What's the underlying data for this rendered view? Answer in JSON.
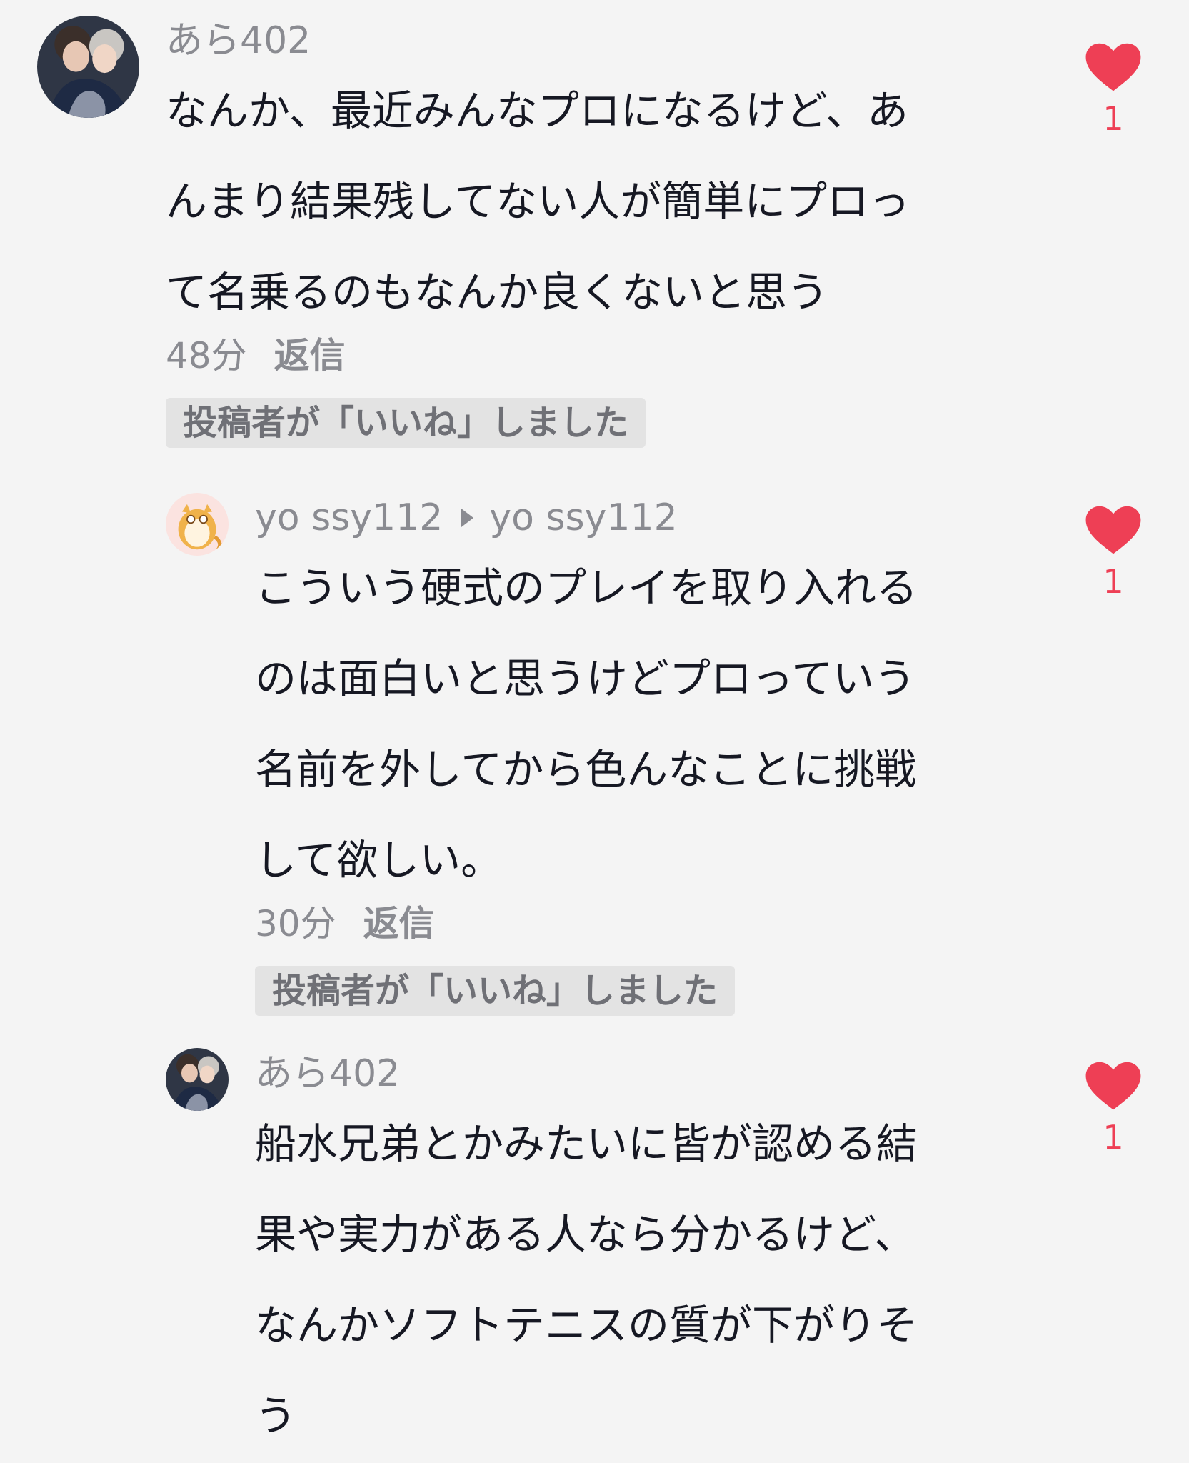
{
  "comments": [
    {
      "username": "あら402",
      "text_lines": [
        "なんか、最近みんなプロになるけど、あ",
        "んまり結果残してない人が簡単にプロっ",
        "て名乗るのもなんか良くないと思う"
      ],
      "time": "48分",
      "reply_label": "返信",
      "badge": "投稿者が「いいね」しました",
      "like_count": "1",
      "avatar_icon": "user-avatar-photo"
    },
    {
      "username": "yo ssy112",
      "reply_to": "yo ssy112",
      "text_lines": [
        "こういう硬式のプレイを取り入れる",
        "のは面白いと思うけどプロっていう",
        "名前を外してから色んなことに挑戦",
        "して欲しい。"
      ],
      "time": "30分",
      "reply_label": "返信",
      "badge": "投稿者が「いいね」しました",
      "like_count": "1",
      "avatar_icon": "user-avatar-cartoon"
    },
    {
      "username": "あら402",
      "text_lines": [
        "船水兄弟とかみたいに皆が認める結",
        "果や実力がある人なら分かるけど、",
        "なんかソフトテニスの質が下がりそ",
        "う"
      ],
      "like_count": "1",
      "avatar_icon": "user-avatar-photo"
    }
  ],
  "colors": {
    "background": "#f4f4f4",
    "like_red": "#ee3f55",
    "muted_text": "#8a8b91",
    "badge_bg": "#e3e3e3"
  }
}
